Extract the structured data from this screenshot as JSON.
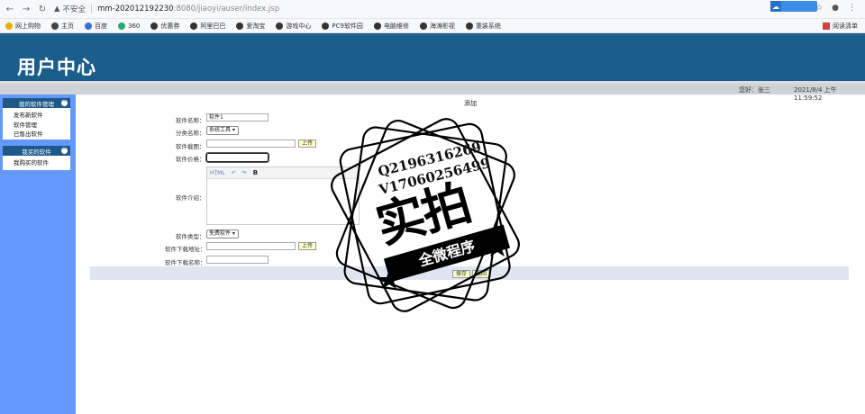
{
  "browser": {
    "security_label": "不安全",
    "url_host": "mm-202012192230",
    "url_path": ":8080/jiaoyi/auser/index.jsp",
    "bookmarks": [
      "网上购物",
      "主页",
      "百度",
      "360",
      "优惠券",
      "阿里巴巴",
      "爱淘宝",
      "游戏中心",
      "PC9软件园",
      "电脑维修",
      "海涛影视",
      "重装系统"
    ],
    "reading_list": "阅读清单"
  },
  "app": {
    "title": "用户中心",
    "greeting": "您好：张三",
    "datetime": "2021/8/4 上午11:59:52"
  },
  "sidebar": {
    "groups": [
      {
        "title": "我的软件管理",
        "items": [
          "发布新软件",
          "软件管理",
          "已售出软件"
        ]
      },
      {
        "title": "我买的软件",
        "items": [
          "我购买的软件"
        ]
      }
    ]
  },
  "form": {
    "title": "添加",
    "name_label": "软件名称：",
    "name_value": "软件1",
    "category_label": "分类名称：",
    "category_value": "系统工具",
    "screenshot_label": "软件截图：",
    "upload_label": "上传",
    "price_label": "软件价格：",
    "intro_label": "软件介绍：",
    "editor_tools": [
      "HTML",
      "↶",
      "↷",
      "B"
    ],
    "type_label": "软件类型：",
    "type_value": "免费软件",
    "download_url_label": "软件下载地址：",
    "download_name_label": "软件下载名称：",
    "save_label": "保存",
    "back_label": "返回"
  },
  "watermark": {
    "line1": "Q2196316269",
    "line2": "V17060256499",
    "big": "实拍",
    "ribbon": "全微程序"
  }
}
